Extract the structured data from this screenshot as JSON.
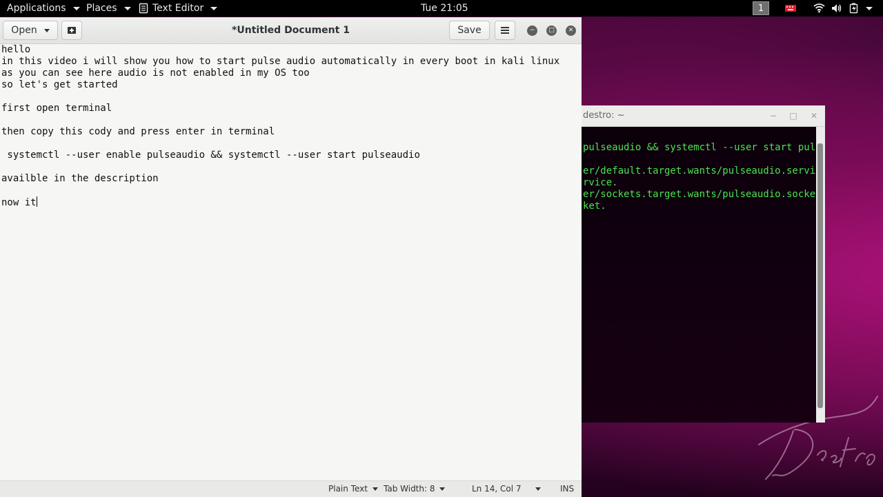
{
  "top_panel": {
    "applications": "Applications",
    "places": "Places",
    "app_menu": "Text Editor",
    "clock": "Tue 21:05",
    "workspace": "1",
    "icons": [
      "keyboard-icon",
      "wifi-icon",
      "volume-icon",
      "battery-icon",
      "power-menu-caret-icon"
    ]
  },
  "gedit": {
    "open_label": "Open",
    "title": "*Untitled Document 1",
    "save_label": "Save",
    "lines": [
      "hello",
      "in this video i will show you how to start pulse audio automatically in every boot in kali linux",
      "as you can see here audio is not enabled in my OS too",
      "so let's get started",
      "",
      "first open terminal",
      "",
      "then copy this cody and press enter in terminal",
      "",
      " systemctl --user enable pulseaudio && systemctl --user start pulseaudio",
      "",
      "availble in the description",
      "",
      "now it"
    ],
    "status": {
      "syntax": "Plain Text",
      "tab_width": "Tab Width: 8",
      "position": "Ln 14, Col 7",
      "mode": "INS"
    }
  },
  "terminal": {
    "title": "destro: ~",
    "lines": [
      "pulseaudio && systemctl --user start pul",
      "",
      "er/default.target.wants/pulseaudio.servi",
      "rvice.",
      "er/sockets.target.wants/pulseaudio.socke",
      "ket."
    ]
  },
  "colors": {
    "terminal_text": "#48e44e",
    "desktop_accent": "#b0127a",
    "panel_bg": "#000000"
  }
}
